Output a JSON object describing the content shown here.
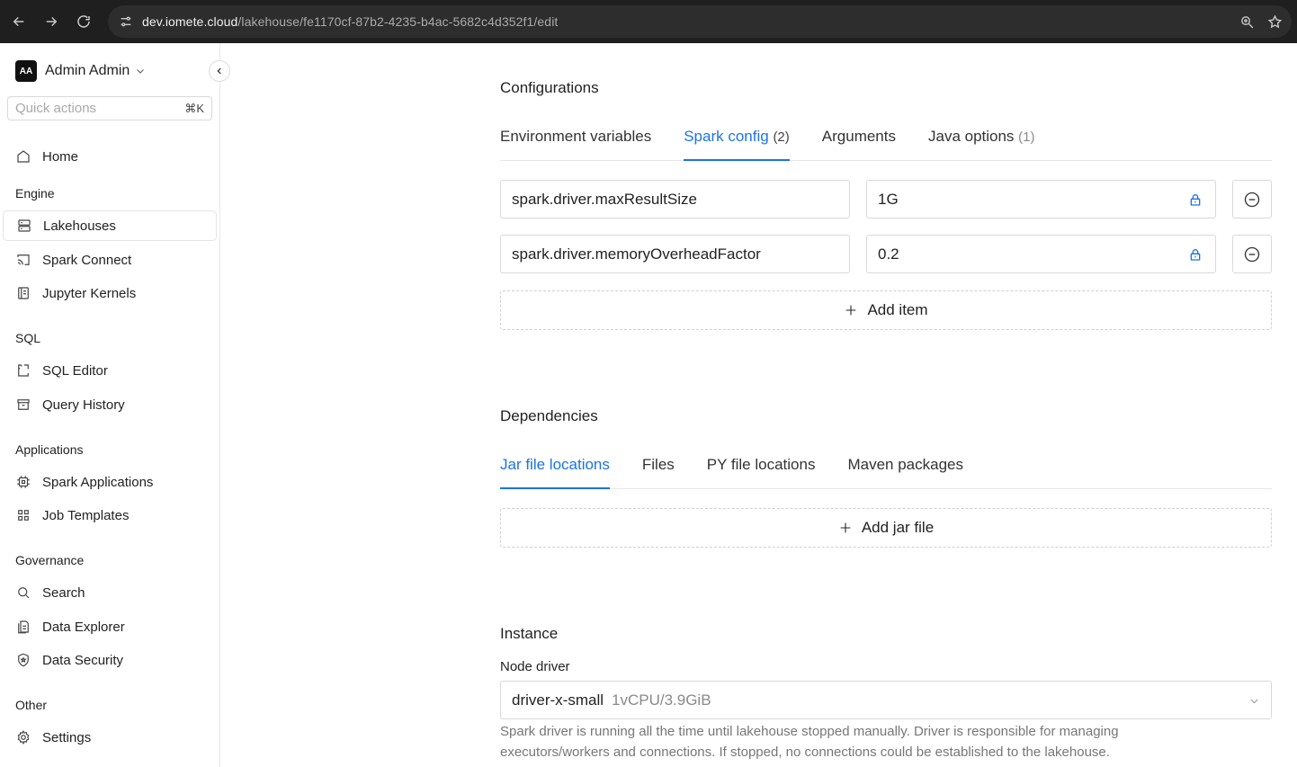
{
  "browser": {
    "url_host": "dev.iomete.cloud",
    "url_path": "/lakehouse/fe1170cf-87b2-4235-b4ac-5682c4d352f1/edit"
  },
  "sidebar": {
    "user": {
      "initials": "AA",
      "name": "Admin Admin"
    },
    "quick_actions": {
      "placeholder": "Quick actions",
      "shortcut": "⌘K"
    },
    "home": "Home",
    "sections": {
      "engine": "Engine",
      "sql": "SQL",
      "applications": "Applications",
      "governance": "Governance",
      "other": "Other"
    },
    "items": {
      "lakehouses": "Lakehouses",
      "spark_connect": "Spark Connect",
      "jupyter_kernels": "Jupyter Kernels",
      "sql_editor": "SQL Editor",
      "query_history": "Query History",
      "spark_applications": "Spark Applications",
      "job_templates": "Job Templates",
      "search": "Search",
      "data_explorer": "Data Explorer",
      "data_security": "Data Security",
      "settings": "Settings"
    }
  },
  "configurations": {
    "title": "Configurations",
    "tabs": [
      {
        "label": "Environment variables",
        "count": ""
      },
      {
        "label": "Spark config",
        "count": "(2)"
      },
      {
        "label": "Arguments",
        "count": ""
      },
      {
        "label": "Java options",
        "count": "(1)"
      }
    ],
    "rows": [
      {
        "key": "spark.driver.maxResultSize",
        "value": "1G"
      },
      {
        "key": "spark.driver.memoryOverheadFactor",
        "value": "0.2"
      }
    ],
    "add_label": "Add item"
  },
  "dependencies": {
    "title": "Dependencies",
    "tabs": [
      "Jar file locations",
      "Files",
      "PY file locations",
      "Maven packages"
    ],
    "add_label": "Add jar file"
  },
  "instance": {
    "title": "Instance",
    "node_driver_label": "Node driver",
    "node_driver_value": "driver-x-small",
    "node_driver_spec": "1vCPU/3.9GiB",
    "help_text": "Spark driver is running all the time until lakehouse stopped manually. Driver is responsible for managing executors/workers and connections. If stopped, no connections could be established to the lakehouse."
  }
}
